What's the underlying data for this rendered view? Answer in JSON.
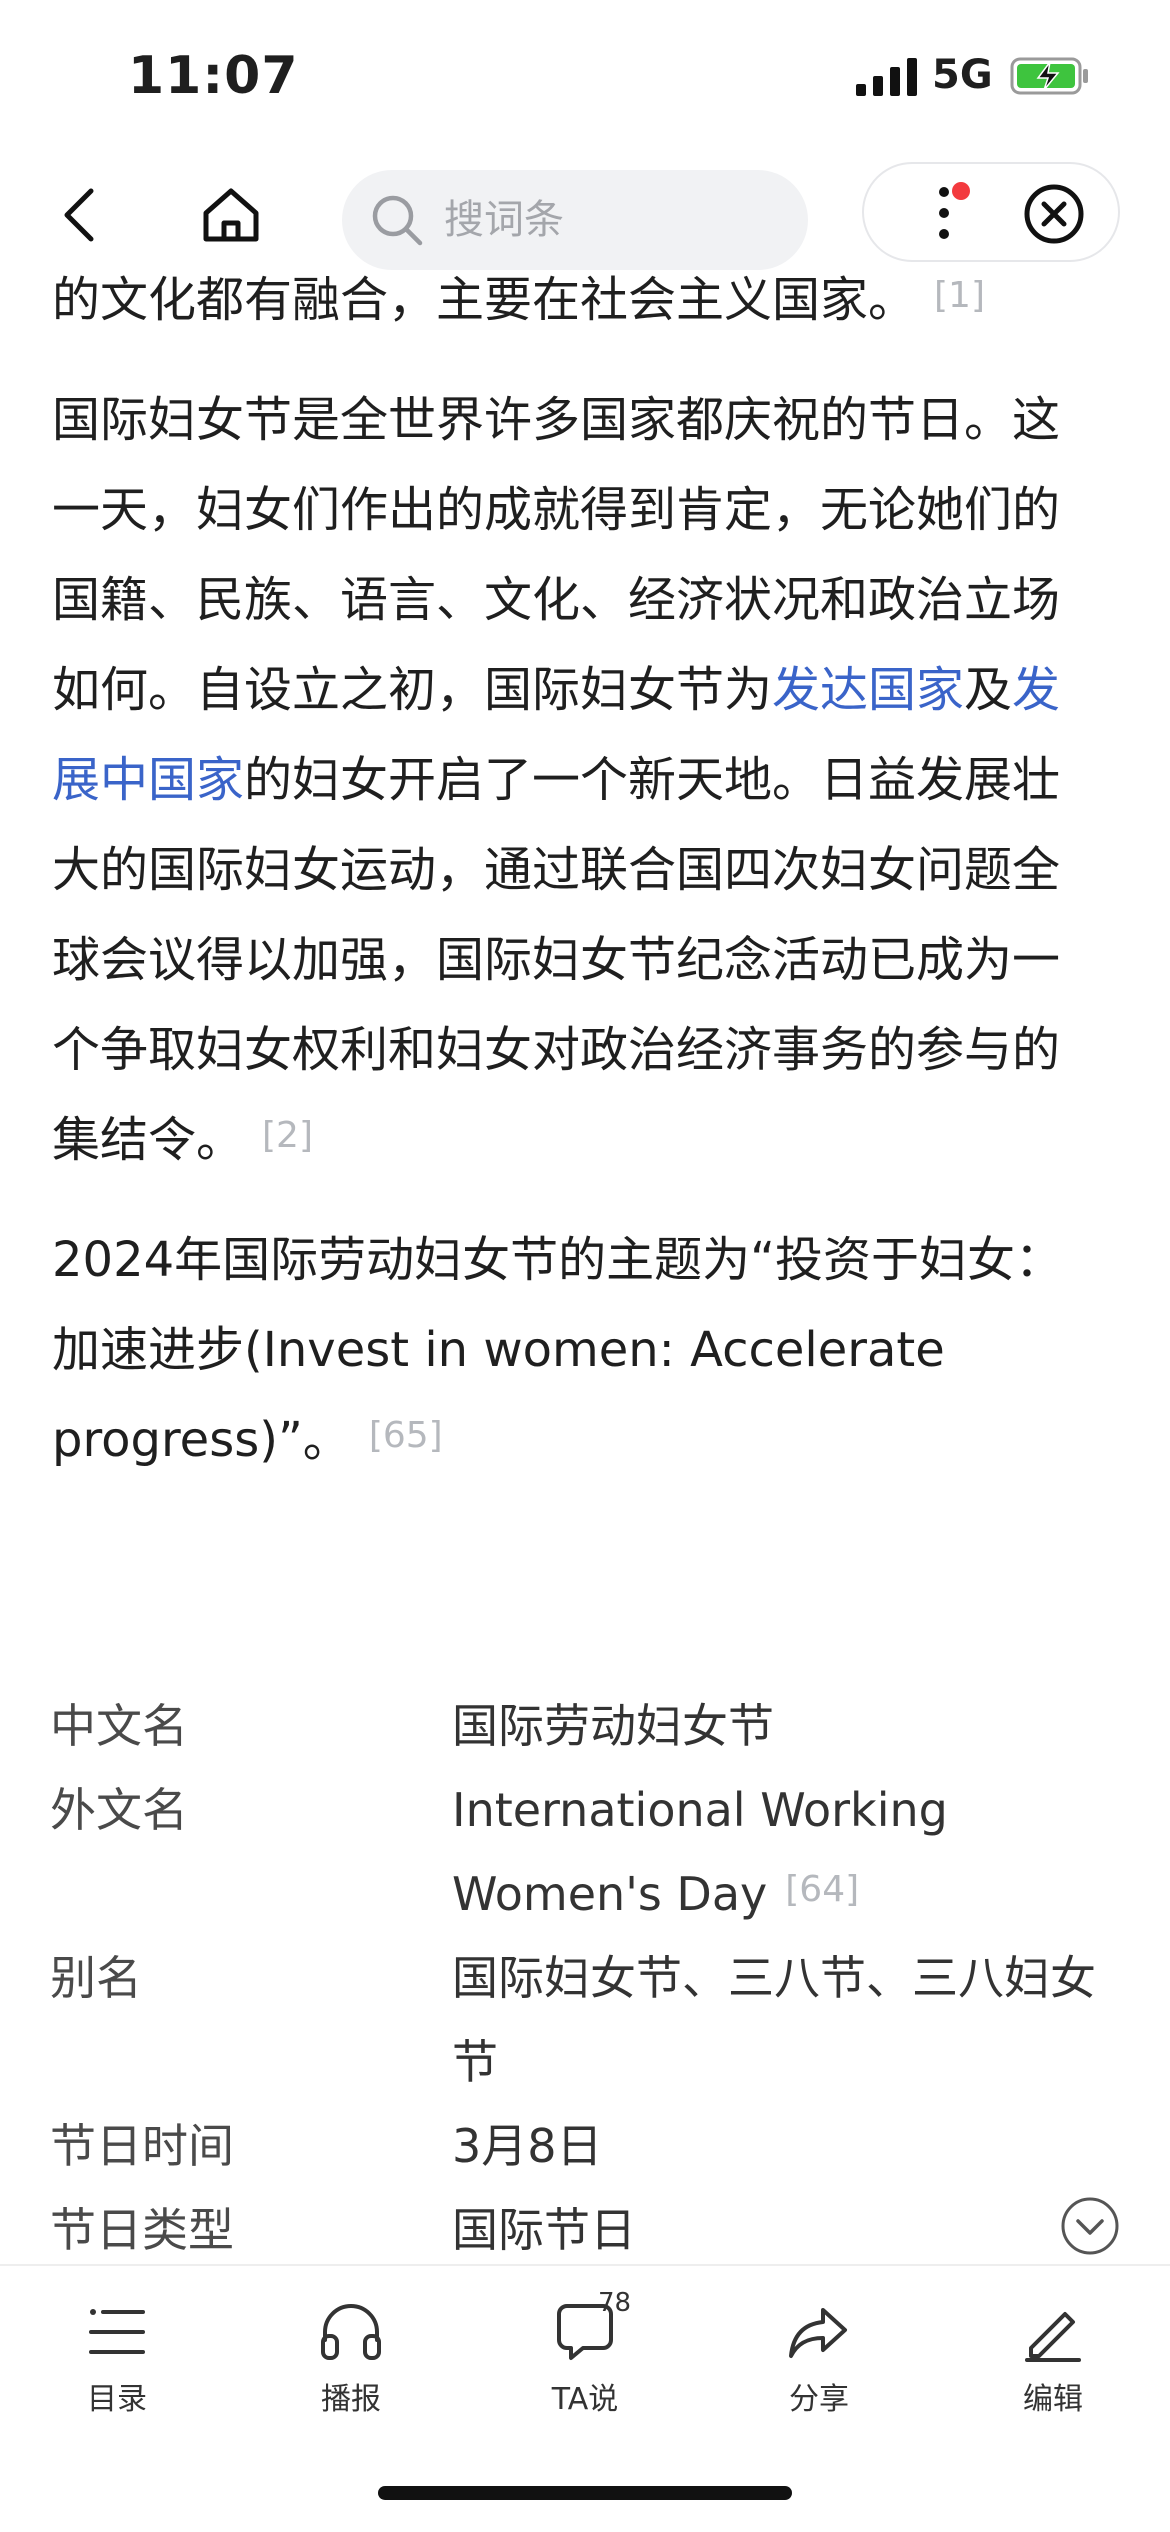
{
  "status": {
    "time": "11:07",
    "network": "5G"
  },
  "nav": {
    "search_placeholder": "搜词条"
  },
  "article": {
    "p0": {
      "text": "的文化都有融合，主要在社会主义国家。",
      "cite": "[1]"
    },
    "p1": {
      "t1": "国际妇女节是全世界许多国家都庆祝的节日。这一天，妇女们作出的成就得到肯定，无论她们的国籍、民族、语言、文化、经济状况和政治立场如何。自设立之初，国际妇女节为",
      "link1": "发达国家",
      "t2": "及",
      "link2": "发展中国家",
      "t3": "的妇女开启了一个新天地。日益发展壮大的国际妇女运动，通过联合国四次妇女问题全球会议得以加强，国际妇女节纪念活动已成为一个争取妇女权利和妇女对政治经济事务的参与的集结令。",
      "cite": "[2]"
    },
    "p2": {
      "text": "2024年国际劳动妇女节的主题为“投资于妇女：加速进步(Invest in women: Accelerate progress)”。",
      "cite": "[65]"
    }
  },
  "infobox": [
    {
      "key": "中文名",
      "value": "国际劳动妇女节",
      "cite": ""
    },
    {
      "key": "外文名",
      "value": "International Working Women's Day",
      "cite": "[64]"
    },
    {
      "key": "别名",
      "value": "国际妇女节、三八节、三八妇女节",
      "cite": ""
    },
    {
      "key": "节日时间",
      "value": "3月8日",
      "cite": ""
    },
    {
      "key": "节日类型",
      "value": "国际节日",
      "cite": ""
    }
  ],
  "tabbar": {
    "toc": "目录",
    "broadcast": "播报",
    "talk": "TA说",
    "talk_count": "78",
    "share": "分享",
    "edit": "编辑"
  },
  "colors": {
    "link": "#3a64c9",
    "badge": "#f33a3e",
    "battery": "#3ec43e"
  }
}
